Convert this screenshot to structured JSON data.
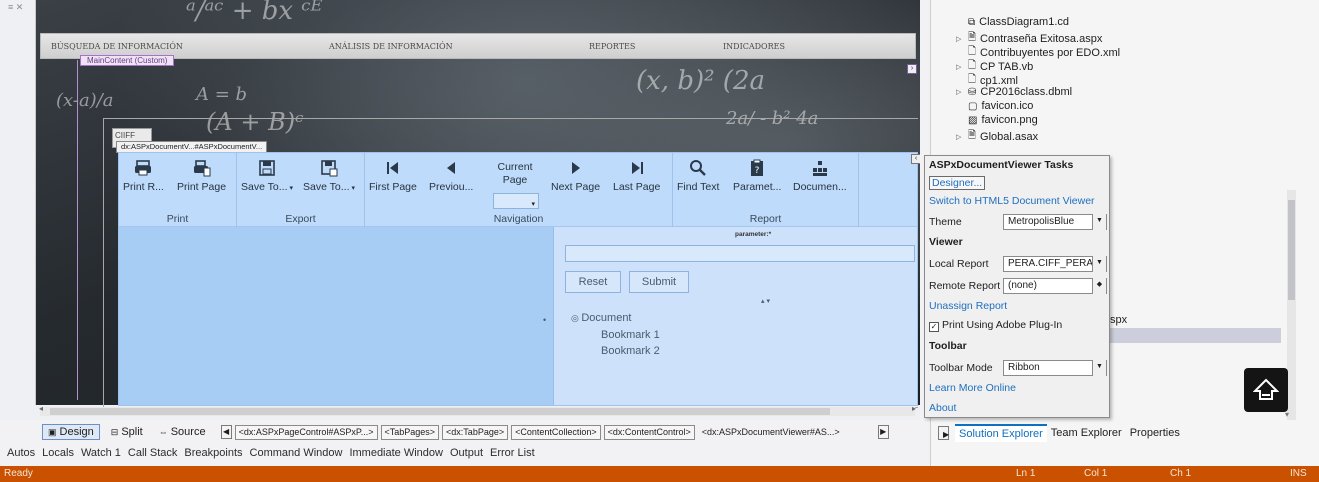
{
  "designer": {
    "chalk_lines": [
      "ᵃ/ᵃᶜ + bx ᶜᴱ",
      "(x-a)/a",
      "(x, b)² (2a",
      "2a/ - b² 4a",
      "(A + B)ᶜ",
      "A = b"
    ],
    "navbar": {
      "items": [
        "BÚSQUEDA DE INFORMACIÓN",
        "ANÁLISIS DE INFORMACIÓN",
        "REPORTES",
        "INDICADORES"
      ]
    },
    "maincontent_tag": "MainContent (Custom)",
    "ciiff_label": "CIIFF",
    "dx_tag": "dx:ASPxDocumentV...#ASPxDocumentV..."
  },
  "ribbon": {
    "groups": [
      {
        "label": "Print",
        "buttons": [
          "Print R...",
          "Print Page"
        ]
      },
      {
        "label": "Export",
        "buttons": [
          "Save To...",
          "Save To..."
        ]
      },
      {
        "label": "Navigation",
        "buttons": [
          "First Page",
          "Previou...",
          "Current Page",
          "Next Page",
          "Last Page"
        ]
      },
      {
        "label": "Report",
        "buttons": [
          "Find Text",
          "Paramet...",
          "Documen..."
        ]
      }
    ]
  },
  "params": {
    "label": "parameter:*",
    "reset": "Reset",
    "submit": "Submit",
    "tree": [
      "Document",
      "Bookmark 1",
      "Bookmark 2"
    ]
  },
  "designbar": {
    "design": "Design",
    "split": "Split",
    "source": "Source",
    "crumbs": [
      "<dx:ASPxPageControl#ASPxP...>",
      "<TabPages>",
      "<dx:TabPage>",
      "<ContentCollection>",
      "<dx:ContentControl>",
      "<dx:ASPxDocumentViewer#AS...>"
    ]
  },
  "bottom_tabs": [
    "Autos",
    "Locals",
    "Watch 1",
    "Call Stack",
    "Breakpoints",
    "Command Window",
    "Immediate Window",
    "Output",
    "Error List"
  ],
  "statusbar": {
    "ready": "Ready",
    "ln": "Ln 1",
    "col": "Col 1",
    "ch": "Ch 1",
    "ins": "INS"
  },
  "solution": {
    "items": [
      {
        "label": "ClassDiagram1.cd",
        "expand": false
      },
      {
        "label": "Contraseña Exitosa.aspx",
        "expand": true
      },
      {
        "label": "Contribuyentes por EDO.xml",
        "expand": false
      },
      {
        "label": "CP TAB.vb",
        "expand": true
      },
      {
        "label": "cp1.xml",
        "expand": false
      },
      {
        "label": "CP2016class.dbml",
        "expand": true
      },
      {
        "label": "favicon.ico",
        "expand": false
      },
      {
        "label": "favicon.png",
        "expand": false
      },
      {
        "label": "Global.asax",
        "expand": true
      }
    ],
    "partial_item": "spx",
    "tabs": [
      "Solution Explorer",
      "Team Explorer",
      "Properties"
    ]
  },
  "tasks": {
    "title": "ASPxDocumentViewer Tasks",
    "designer": "Designer...",
    "switch_html5": "Switch to HTML5 Document Viewer",
    "theme_label": "Theme",
    "theme_value": "MetropolisBlue",
    "viewer_header": "Viewer",
    "local_report_label": "Local Report",
    "local_report_value": "PERA.CIFF_PERA",
    "remote_report_label": "Remote Report",
    "remote_report_value": "(none)",
    "unassign": "Unassign Report",
    "print_adobe": "Print Using Adobe Plug-In",
    "print_adobe_checked": true,
    "toolbar_header": "Toolbar",
    "toolbar_mode_label": "Toolbar Mode",
    "toolbar_mode_value": "Ribbon",
    "learn_more": "Learn More Online",
    "about": "About"
  },
  "colors": {
    "accent": "#ca5100",
    "ribbon": "#bfdbfb",
    "link": "#1f6fbf",
    "selection": "#cccedb"
  }
}
